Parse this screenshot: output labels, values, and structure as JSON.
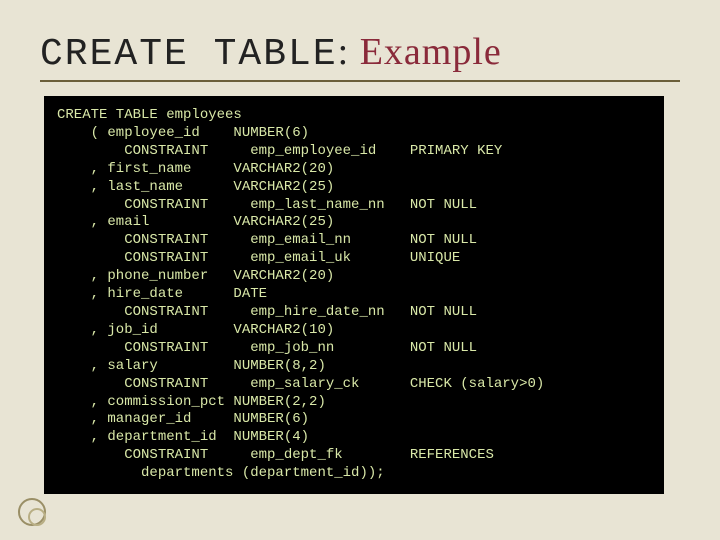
{
  "title": {
    "mono": "CREATE TABLE",
    "sep": ": ",
    "example": "Example"
  },
  "code": "CREATE TABLE employees\n    ( employee_id    NUMBER(6)\n        CONSTRAINT     emp_employee_id    PRIMARY KEY\n    , first_name     VARCHAR2(20)\n    , last_name      VARCHAR2(25)\n        CONSTRAINT     emp_last_name_nn   NOT NULL\n    , email          VARCHAR2(25)\n        CONSTRAINT     emp_email_nn       NOT NULL\n        CONSTRAINT     emp_email_uk       UNIQUE\n    , phone_number   VARCHAR2(20)\n    , hire_date      DATE\n        CONSTRAINT     emp_hire_date_nn   NOT NULL\n    , job_id         VARCHAR2(10)\n        CONSTRAINT     emp_job_nn         NOT NULL\n    , salary         NUMBER(8,2)\n        CONSTRAINT     emp_salary_ck      CHECK (salary>0)\n    , commission_pct NUMBER(2,2)\n    , manager_id     NUMBER(6)\n    , department_id  NUMBER(4)\n        CONSTRAINT     emp_dept_fk        REFERENCES\n          departments (department_id));"
}
